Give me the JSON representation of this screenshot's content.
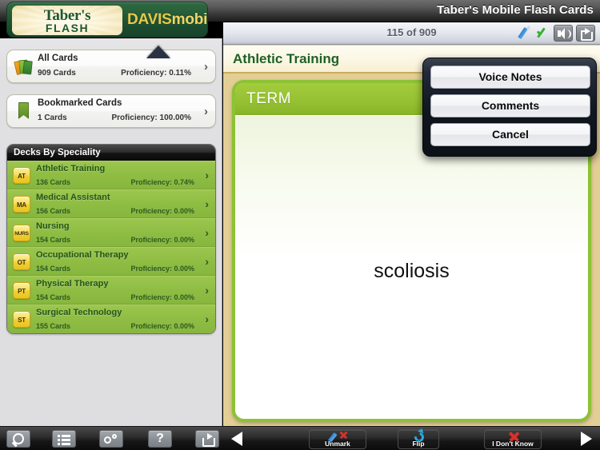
{
  "titlebar": {
    "app_title": "Taber's Mobile Flash Cards",
    "logo": {
      "brand_top": "Taber's",
      "brand_bottom": "FLASH",
      "publisher": "DAVIS",
      "publisher_suffix": "mobile"
    }
  },
  "sidebar": {
    "summary_cards": [
      {
        "icon": "card-stack-icon",
        "title": "All Cards",
        "count": "909 Cards",
        "proficiency": "Proficiency: 0.11%",
        "chevron": "›"
      },
      {
        "icon": "bookmark-icon",
        "title": "Bookmarked Cards",
        "count": "1 Cards",
        "proficiency": "Proficiency: 100.00%",
        "chevron": "›"
      }
    ],
    "decks_header": "Decks By Speciality",
    "decks": [
      {
        "badge": "AT",
        "name": "Athletic Training",
        "count": "136 Cards",
        "proficiency": "Proficiency: 0.74%",
        "chevron": "›"
      },
      {
        "badge": "MA",
        "name": "Medical Assistant",
        "count": "156 Cards",
        "proficiency": "Proficiency: 0.00%",
        "chevron": "›"
      },
      {
        "badge": "NURS",
        "name": "Nursing",
        "count": "154 Cards",
        "proficiency": "Proficiency: 0.00%",
        "chevron": "›"
      },
      {
        "badge": "OT",
        "name": "Occupational Therapy",
        "count": "154 Cards",
        "proficiency": "Proficiency: 0.00%",
        "chevron": "›"
      },
      {
        "badge": "PT",
        "name": "Physical Therapy",
        "count": "154 Cards",
        "proficiency": "Proficiency: 0.00%",
        "chevron": "›"
      },
      {
        "badge": "ST",
        "name": "Surgical Technology",
        "count": "155 Cards",
        "proficiency": "Proficiency: 0.00%",
        "chevron": "›"
      }
    ],
    "toolbar": [
      {
        "icon": "search-icon",
        "name": "search-button"
      },
      {
        "icon": "list-icon",
        "name": "list-button"
      },
      {
        "icon": "gears-icon",
        "name": "settings-button"
      },
      {
        "icon": "question-icon",
        "name": "help-button",
        "glyph": "?"
      },
      {
        "icon": "share-icon",
        "name": "share-button"
      }
    ]
  },
  "main": {
    "counter": "115 of 909",
    "header_icons": [
      {
        "icon": "pencil-icon",
        "color": "#2f7fd0"
      },
      {
        "icon": "check-icon",
        "color": "#35b22e"
      },
      {
        "icon": "speaker-icon",
        "color": "#85898f"
      },
      {
        "icon": "share-icon",
        "color": "#85898f"
      }
    ],
    "deck_title": "Athletic Training",
    "card": {
      "side_label": "TERM",
      "term": "scoliosis"
    },
    "toolbar": {
      "prev_label": "◀",
      "next_label": "▶",
      "actions": [
        {
          "label": "Unmark",
          "icon": "unmark-icon"
        },
        {
          "label": "Flip",
          "icon": "flip-icon"
        },
        {
          "label": "I Don't Know",
          "icon": "dont-know-icon"
        }
      ]
    }
  },
  "popover": {
    "buttons": [
      {
        "label": "Voice Notes"
      },
      {
        "label": "Comments"
      },
      {
        "label": "Cancel"
      }
    ]
  },
  "colors": {
    "brand_green": "#1f6126",
    "accent_green": "#8cc234",
    "row_green": "#96c233",
    "badge_yellow": "#f2d035",
    "panel_tan": "#e3cf95",
    "sidebar_gray": "#e0e0e2"
  }
}
